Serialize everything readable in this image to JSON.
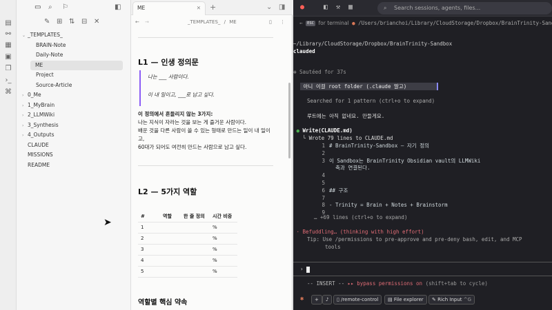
{
  "sidebar": {
    "folders": [
      {
        "label": "_TEMPLATES_",
        "open": true
      },
      {
        "label": "BRAIN-Note"
      },
      {
        "label": "Daily-Note"
      },
      {
        "label": "ME",
        "selected": true
      },
      {
        "label": "Project"
      },
      {
        "label": "Source-Article"
      },
      {
        "label": "0_Me"
      },
      {
        "label": "1_MyBrain"
      },
      {
        "label": "2_LLMWiki"
      },
      {
        "label": "3_Synthesis"
      },
      {
        "label": "4_Outputs"
      },
      {
        "label": "CLAUDE"
      },
      {
        "label": "MISSIONS"
      },
      {
        "label": "README"
      }
    ]
  },
  "editor": {
    "tab_title": "ME",
    "breadcrumb_folder": "_TEMPLATES_",
    "breadcrumb_sep": "/",
    "breadcrumb_file": "ME",
    "h_l1": "L1 — 인생 정의문",
    "quote1": "나는 ___ 사람이다.",
    "quote2": "이 내 일이고, ___로 남고 싶다.",
    "bold_line": "이 정의에서 흔들리지 않는 3가지:",
    "line1": "나는 지식이 자라는 것을 보는 게 즐거운 사람이다.",
    "line2": "배운 것을 다른 사람이 쓸 수 있는 형태로 만드는 일이 내 일이고,",
    "line3": "60대가 되어도 여전히 만드는 사람으로 남고 싶다.",
    "h_l2": "L2 — 5가지 역할",
    "table_headers": [
      "#",
      "역할",
      "한 줄 정의",
      "시간 비중"
    ],
    "table_rows": [
      [
        "1",
        "",
        "",
        "%"
      ],
      [
        "2",
        "",
        "",
        "%"
      ],
      [
        "3",
        "",
        "",
        "%"
      ],
      [
        "4",
        "",
        "",
        "%"
      ],
      [
        "5",
        "",
        "",
        "%"
      ]
    ],
    "h_roles": "역할별 핵심 약속"
  },
  "terminal": {
    "search_placeholder": "Search sessions, agents, files...",
    "esc_key": "ESC",
    "for_terminal": "for terminal",
    "path_header": "/Users/brianchoi/Library/CloudStorage/Dropbox/BrainTrinity-Sandbox/.claude/CLA",
    "cwd": "~/Library/CloudStorage/Dropbox/BrainTrinity-Sandbox",
    "session": "clauded",
    "saute": "✻ Sautéed for 37s",
    "user_msg": " 아니 이걸 root folder (.claude 말고) ",
    "searched": "Searched for 1 pattern (ctrl+o to expand)",
    "reply": "루트에는 아직 없네요. 만들게요.",
    "write_call": "Write(CLAUDE.md)",
    "wrote": "Wrote 79 lines to CLAUDE.md",
    "lines": [
      {
        "n": "1",
        "t": "# BrainTrinity-Sandbox — 자기 정의"
      },
      {
        "n": "2",
        "t": ""
      },
      {
        "n": "3",
        "t": "이 Sandbox는 BrainTrinity Obsidian vault의 LLMWiki"
      },
      {
        "n": "",
        "t": "  축과 연결된다."
      },
      {
        "n": "4",
        "t": ""
      },
      {
        "n": "5",
        "t": ""
      },
      {
        "n": "6",
        "t": "## 구조"
      },
      {
        "n": "7",
        "t": ""
      },
      {
        "n": "8",
        "t": "- Trinity = Brain + Notes + Brainstorm"
      },
      {
        "n": "9",
        "t": ""
      }
    ],
    "more": "… +69 lines (ctrl+o to expand)",
    "status": "Befuddling… (thinking with high effort)",
    "tip1": "Tip: Use /permissions to pre-approve and pre-deny bash, edit, and MCP",
    "tip2": "tools",
    "prompt": "›",
    "mode": "-- INSERT --",
    "bypass": "▸▸ bypass permissions on",
    "cycle": "(shift+tab to cycle)",
    "pill_remote": "/remote-control",
    "pill_files": "File explorer",
    "pill_rich": "Rich Input",
    "pill_rich_key": "^G",
    "accent": "#d97757"
  }
}
